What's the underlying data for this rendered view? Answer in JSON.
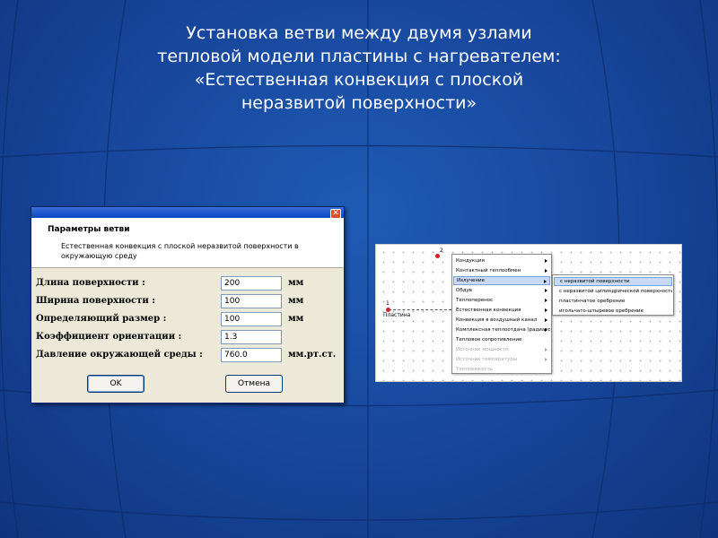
{
  "slide": {
    "title_lines": [
      "Установка ветви между двумя узлами",
      "тепловой модели пластины с нагревателем:",
      "«Естественная конвекция с плоской",
      "неразвитой поверхности»"
    ],
    "background_color": "#17459a"
  },
  "dialog": {
    "title": "Параметры ветви",
    "description": "Естественная конвекция с плоской неразвитой поверхности в окружающую среду",
    "close_icon": "close-icon",
    "params": [
      {
        "label": "Длина поверхности :",
        "value": "200",
        "unit": "мм"
      },
      {
        "label": "Ширина поверхности :",
        "value": "100",
        "unit": "мм"
      },
      {
        "label": "Определяющий размер :",
        "value": "100",
        "unit": "мм"
      },
      {
        "label": "Коэффициент ориентации :",
        "value": "1.3",
        "unit": ""
      },
      {
        "label": "Давление окружающей среды :",
        "value": "760.0",
        "unit": "мм.рт.ст."
      }
    ],
    "ok_label": "OK",
    "cancel_label": "Отмена"
  },
  "editor": {
    "node_1": "1",
    "node_2": "2",
    "plate_label": "Пластина",
    "menu": [
      {
        "label": "Кондукция",
        "disabled": false,
        "arrow": true
      },
      {
        "label": "Контактный теплообмен",
        "disabled": false,
        "arrow": true
      },
      {
        "label": "Излучение",
        "disabled": false,
        "arrow": true,
        "highlighted": true
      },
      {
        "label": "Обдув",
        "disabled": false,
        "arrow": true
      },
      {
        "label": "Теплоперенос",
        "disabled": false,
        "arrow": true
      },
      {
        "label": "Естественная конвекция",
        "disabled": false,
        "arrow": true
      },
      {
        "label": "Конвекция в воздушный канал",
        "disabled": false,
        "arrow": true
      },
      {
        "label": "Комплексная теплоотдача (радиатор)",
        "disabled": false,
        "arrow": true
      },
      {
        "label": "Тепловое сопротивление",
        "disabled": false,
        "arrow": false
      },
      {
        "label": "Источник мощности",
        "disabled": true,
        "arrow": true
      },
      {
        "label": "Источник температуры",
        "disabled": true,
        "arrow": true
      },
      {
        "label": "Теплоемкость",
        "disabled": true,
        "arrow": false
      }
    ],
    "submenu": [
      {
        "label": "с неразвитой поверхности",
        "highlighted": true
      },
      {
        "label": "с неразвитой цилиндрической поверхности",
        "highlighted": false
      },
      {
        "label": "пластинчатое оребрение",
        "highlighted": false
      },
      {
        "label": "игольчато-штыревое оребрение",
        "highlighted": false
      }
    ]
  }
}
